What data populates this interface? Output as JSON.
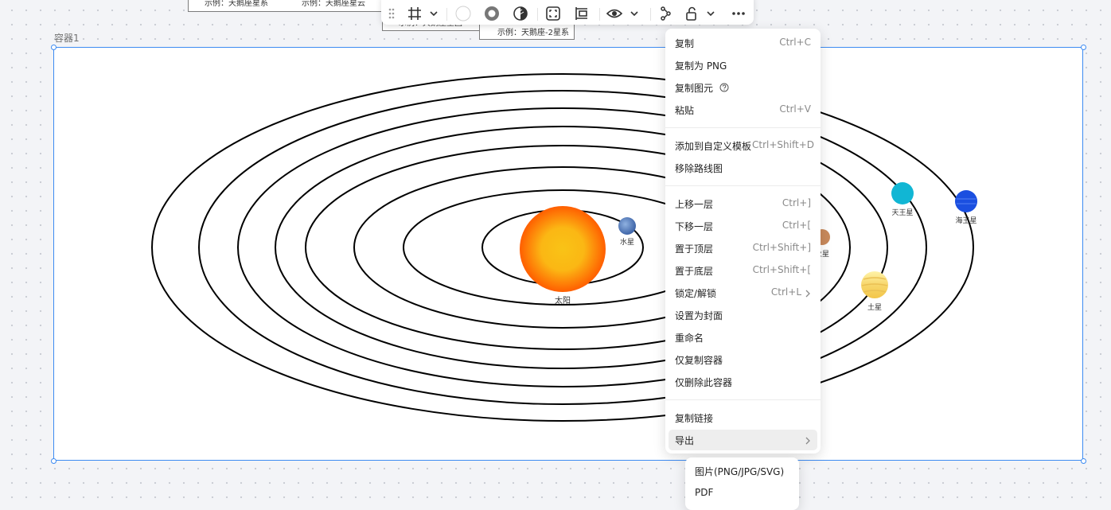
{
  "background_notes": [
    {
      "text": "示例：天鹅座星系"
    },
    {
      "text": "示例：天鹅座星云"
    },
    {
      "text": "示例：天鹅座星团"
    },
    {
      "text": "示例：天鹅座-2星系"
    }
  ],
  "container": {
    "label": "容器1"
  },
  "solar_system": {
    "sun": "太阳",
    "planets": [
      "水星",
      "火星",
      "天王星",
      "海王星",
      "土星"
    ]
  },
  "toolbar": {
    "icons": [
      "drag-handle-icon",
      "frame-icon",
      "fill-color-icon",
      "stroke-color-icon",
      "opacity-icon",
      "fit-icon",
      "layout-icon",
      "visibility-icon",
      "connect-icon",
      "lock-icon",
      "more-icon"
    ]
  },
  "context_menu": {
    "groups": [
      [
        {
          "label": "复制",
          "shortcut": "Ctrl+C"
        },
        {
          "label": "复制为 PNG",
          "shortcut": ""
        },
        {
          "label": "复制图元",
          "shortcut": ""
        },
        {
          "label": "粘贴",
          "shortcut": "Ctrl+V"
        }
      ],
      [
        {
          "label": "添加到自定义模板",
          "shortcut": "Ctrl+Shift+D"
        },
        {
          "label": "移除路线图",
          "shortcut": ""
        }
      ],
      [
        {
          "label": "上移一层",
          "shortcut": "Ctrl+]"
        },
        {
          "label": "下移一层",
          "shortcut": "Ctrl+["
        },
        {
          "label": "置于顶层",
          "shortcut": "Ctrl+Shift+]"
        },
        {
          "label": "置于底层",
          "shortcut": "Ctrl+Shift+["
        },
        {
          "label": "锁定/解锁",
          "shortcut": "Ctrl+L"
        },
        {
          "label": "设置为封面",
          "shortcut": ""
        },
        {
          "label": "重命名",
          "shortcut": ""
        },
        {
          "label": "仅复制容器",
          "shortcut": ""
        },
        {
          "label": "仅删除此容器",
          "shortcut": ""
        }
      ],
      [
        {
          "label": "复制链接",
          "shortcut": ""
        },
        {
          "label": "导出",
          "shortcut": ""
        }
      ]
    ]
  },
  "export_submenu": {
    "items": [
      "图片(PNG/JPG/SVG)",
      "PDF"
    ]
  },
  "colors": {
    "accent": "#3d8bf2",
    "sun_outer": "#ff6a00",
    "sun_inner": "#f9c316"
  }
}
